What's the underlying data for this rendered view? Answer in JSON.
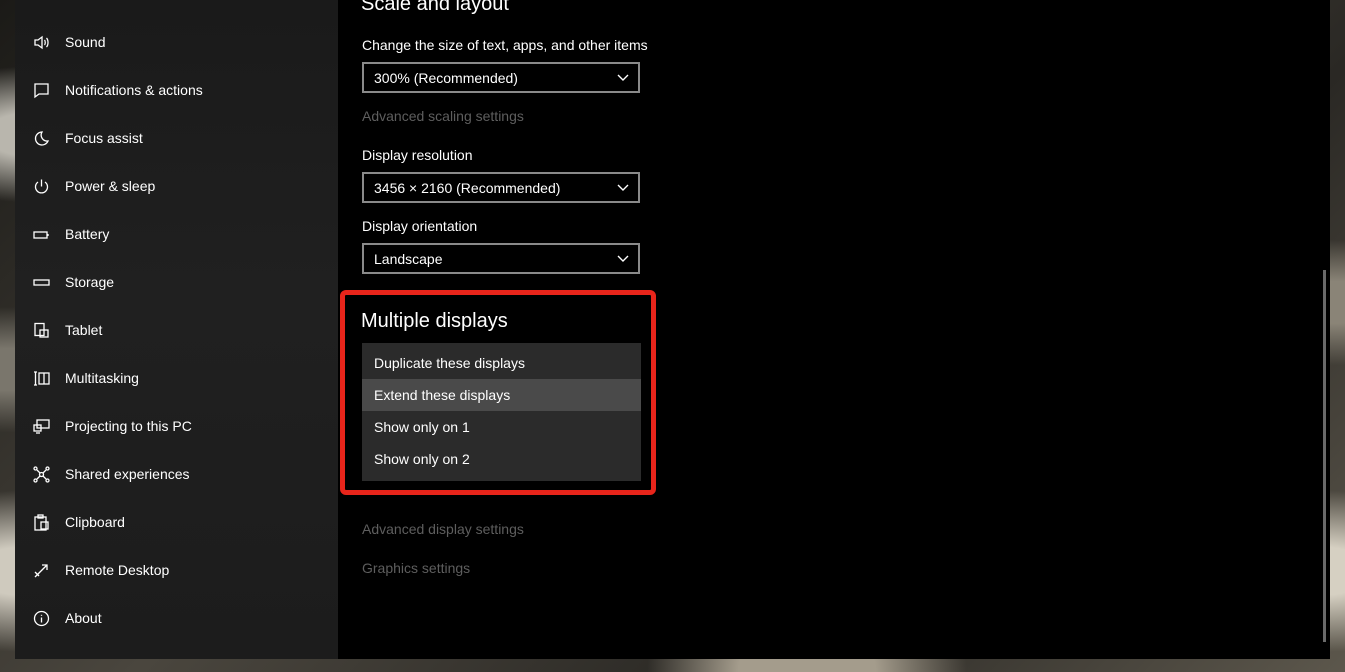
{
  "sidebar": {
    "items": [
      {
        "label": "Sound",
        "icon": "speaker-icon"
      },
      {
        "label": "Notifications & actions",
        "icon": "notification-icon"
      },
      {
        "label": "Focus assist",
        "icon": "moon-icon"
      },
      {
        "label": "Power & sleep",
        "icon": "power-icon"
      },
      {
        "label": "Battery",
        "icon": "battery-icon"
      },
      {
        "label": "Storage",
        "icon": "storage-icon"
      },
      {
        "label": "Tablet",
        "icon": "tablet-icon"
      },
      {
        "label": "Multitasking",
        "icon": "multitasking-icon"
      },
      {
        "label": "Projecting to this PC",
        "icon": "projecting-icon"
      },
      {
        "label": "Shared experiences",
        "icon": "shared-icon"
      },
      {
        "label": "Clipboard",
        "icon": "clipboard-icon"
      },
      {
        "label": "Remote Desktop",
        "icon": "remote-icon"
      },
      {
        "label": "About",
        "icon": "info-icon"
      }
    ]
  },
  "main": {
    "section_title": "Scale and layout",
    "scale_label": "Change the size of text, apps, and other items",
    "scale_value": "300% (Recommended)",
    "advanced_scaling": "Advanced scaling settings",
    "resolution_label": "Display resolution",
    "resolution_value": "3456 × 2160 (Recommended)",
    "orientation_label": "Display orientation",
    "orientation_value": "Landscape",
    "multiple_displays_title": "Multiple displays",
    "multiple_displays_options": [
      "Duplicate these displays",
      "Extend these displays",
      "Show only on 1",
      "Show only on 2"
    ],
    "selected_option": "Extend these displays",
    "advanced_display": "Advanced display settings",
    "graphics_settings": "Graphics settings"
  },
  "colors": {
    "highlight_border": "#e8251b",
    "background": "#000000",
    "sidebar": "#1e1e1e"
  }
}
